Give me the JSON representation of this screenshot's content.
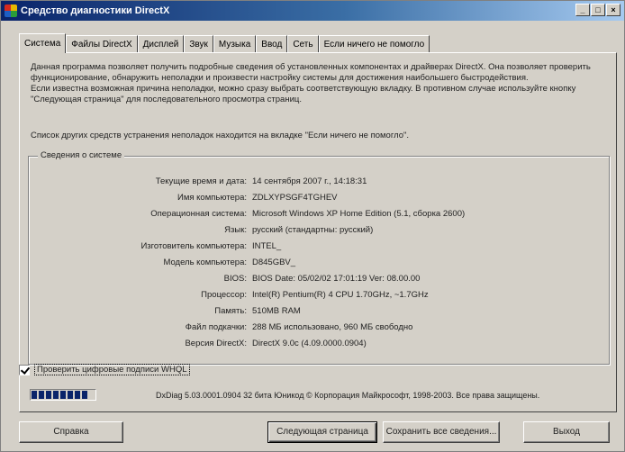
{
  "window": {
    "title": "Средство диагностики DirectX",
    "controls": [
      "_",
      "□",
      "×"
    ]
  },
  "tabs": [
    {
      "label": "Система",
      "active": true
    },
    {
      "label": "Файлы DirectX"
    },
    {
      "label": "Дисплей"
    },
    {
      "label": "Звук"
    },
    {
      "label": "Музыка"
    },
    {
      "label": "Ввод"
    },
    {
      "label": "Сеть"
    },
    {
      "label": "Если ничего не помогло"
    }
  ],
  "intro": {
    "line1": "Данная программа позволяет получить подробные сведения об установленных компонентах и драйверах DirectX. Она позволяет проверить функционирование, обнаружить неполадки и произвести настройку системы для достижения наибольшего быстродействия.",
    "line2": "Если известна возможная причина неполадки, можно сразу выбрать соответствующую вкладку. В противном случае используйте кнопку \"Следующая страница\" для последовательного просмотра страниц.",
    "other_tools": "Список других средств устранения неполадок находится на вкладке \"Если ничего не помогло\"."
  },
  "system_info": {
    "legend": "Сведения о системе",
    "rows": [
      {
        "label": "Текущие время и дата:",
        "value": "14 сентября 2007 г., 14:18:31"
      },
      {
        "label": "Имя компьютера:",
        "value": "ZDLXYPSGF4TGHEV"
      },
      {
        "label": "Операционная система:",
        "value": "Microsoft Windows XP Home Edition (5.1, сборка 2600)"
      },
      {
        "label": "Язык:",
        "value": "русский (стандартны: русский)"
      },
      {
        "label": "Изготовитель компьютера:",
        "value": "INTEL_"
      },
      {
        "label": "Модель компьютера:",
        "value": "D845GBV_"
      },
      {
        "label": "BIOS:",
        "value": "BIOS Date: 05/02/02 17:01:19 Ver: 08.00.00"
      },
      {
        "label": "Процессор:",
        "value": "Intel(R) Pentium(R) 4 CPU 1.70GHz, ~1.7GHz"
      },
      {
        "label": "Память:",
        "value": "510MB RAM"
      },
      {
        "label": "Файл подкачки:",
        "value": "288 МБ использовано, 960 МБ свободно"
      },
      {
        "label": "Версия DirectX:",
        "value": "DirectX 9.0c (4.09.0000.0904)"
      }
    ]
  },
  "whql": {
    "label": "Проверить цифровые подписи WHQL",
    "checked": true
  },
  "progress": {
    "chunks": 8
  },
  "footer": {
    "copyright": "DxDiag 5.03.0001.0904 32 бита Юникод  © Корпорация Майкрософт, 1998-2003.  Все права защищены."
  },
  "buttons": {
    "help": "Справка",
    "next": "Следующая страница",
    "save": "Сохранить все сведения...",
    "exit": "Выход"
  },
  "colors": {
    "titlebar_start": "#0a246a",
    "titlebar_end": "#a6caf0",
    "face": "#d4d0c8",
    "progress": "#0a246a"
  }
}
